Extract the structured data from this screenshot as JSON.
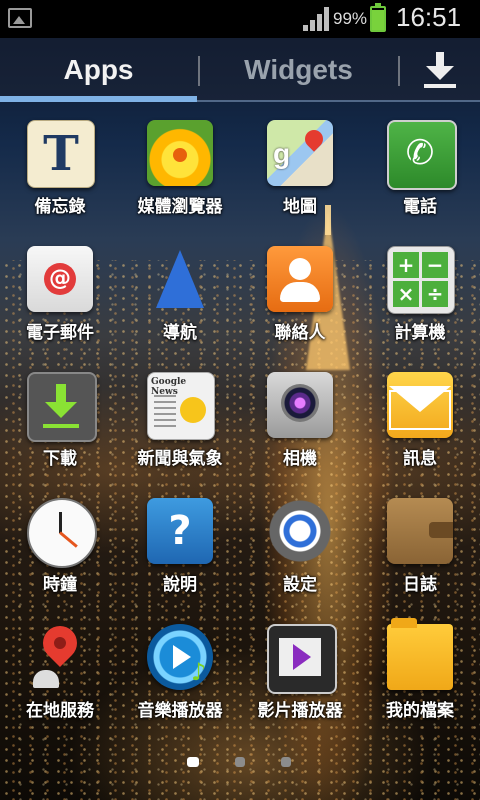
{
  "status_bar": {
    "battery_percent": "99%",
    "time": "16:51",
    "icons": [
      "gallery-icon",
      "signal-icon",
      "battery-icon"
    ]
  },
  "tabs": {
    "apps_label": "Apps",
    "widgets_label": "Widgets",
    "active": "Apps",
    "download_icon": "download-icon"
  },
  "apps": [
    {
      "label": "備忘錄",
      "icon": "memo-icon"
    },
    {
      "label": "媒體瀏覽器",
      "icon": "browser-icon"
    },
    {
      "label": "地圖",
      "icon": "map-icon"
    },
    {
      "label": "電話",
      "icon": "phone-icon"
    },
    {
      "label": "電子郵件",
      "icon": "email-icon"
    },
    {
      "label": "導航",
      "icon": "navigation-icon"
    },
    {
      "label": "聯絡人",
      "icon": "contacts-icon"
    },
    {
      "label": "計算機",
      "icon": "calculator-icon"
    },
    {
      "label": "下載",
      "icon": "download-icon"
    },
    {
      "label": "新聞與氣象",
      "icon": "news-weather-icon"
    },
    {
      "label": "相機",
      "icon": "camera-icon"
    },
    {
      "label": "訊息",
      "icon": "message-icon"
    },
    {
      "label": "時鐘",
      "icon": "clock-icon"
    },
    {
      "label": "說明",
      "icon": "help-icon"
    },
    {
      "label": "設定",
      "icon": "settings-icon"
    },
    {
      "label": "日誌",
      "icon": "diary-icon"
    },
    {
      "label": "在地服務",
      "icon": "local-pin-icon"
    },
    {
      "label": "音樂播放器",
      "icon": "music-player-icon"
    },
    {
      "label": "影片播放器",
      "icon": "video-player-icon"
    },
    {
      "label": "我的檔案",
      "icon": "folder-icon"
    }
  ],
  "pager": {
    "pages": 3,
    "active_page": 1
  },
  "colors": {
    "tab_accent": "#7fb2e6",
    "battery": "#79d23c"
  }
}
